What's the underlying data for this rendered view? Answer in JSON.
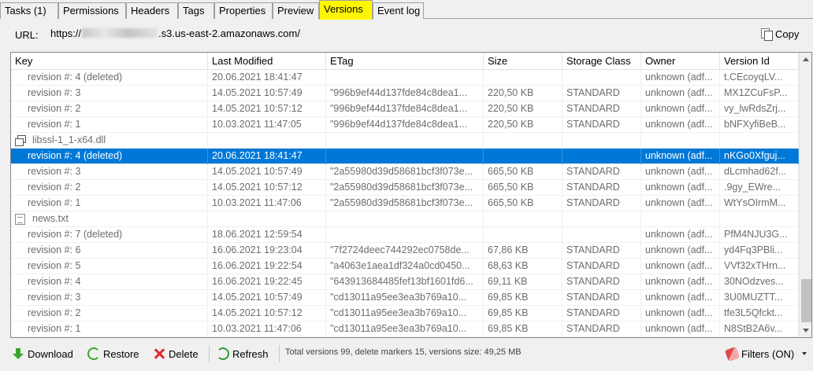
{
  "tabs": [
    "Tasks (1)",
    "Permissions",
    "Headers",
    "Tags",
    "Properties",
    "Preview",
    "Versions",
    "Event log"
  ],
  "active_tab": "Versions",
  "url": {
    "label": "URL:",
    "prefix": "https://",
    "suffix": ".s3.us-east-2.amazonaws.com/"
  },
  "copy_label": "Copy",
  "columns": [
    "Key",
    "Last Modified",
    "ETag",
    "Size",
    "Storage Class",
    "Owner",
    "Version Id"
  ],
  "rows": [
    {
      "type": "rev",
      "key": "revision #: 4 (deleted)",
      "modified": "20.06.2021 18:41:47",
      "etag": "",
      "size": "",
      "class": "",
      "owner": "unknown (adf...",
      "version": "t.CEcoyqLV..."
    },
    {
      "type": "rev",
      "key": "revision #: 3",
      "modified": "14.05.2021 10:57:49",
      "etag": "\"996b9ef44d137fde84c8dea1...",
      "size": "220,50 KB",
      "class": "STANDARD",
      "owner": "unknown (adf...",
      "version": "MX1ZCuFsP..."
    },
    {
      "type": "rev",
      "key": "revision #: 2",
      "modified": "14.05.2021 10:57:12",
      "etag": "\"996b9ef44d137fde84c8dea1...",
      "size": "220,50 KB",
      "class": "STANDARD",
      "owner": "unknown (adf...",
      "version": "vy_lwRdsZrj..."
    },
    {
      "type": "rev",
      "key": "revision #: 1",
      "modified": "10.03.2021 11:47:05",
      "etag": "\"996b9ef44d137fde84c8dea1...",
      "size": "220,50 KB",
      "class": "STANDARD",
      "owner": "unknown (adf...",
      "version": "bNFXyfiBeB..."
    },
    {
      "type": "file",
      "icon": "dll",
      "key": "libssl-1_1-x64.dll",
      "modified": "",
      "etag": "",
      "size": "",
      "class": "",
      "owner": "",
      "version": ""
    },
    {
      "type": "rev",
      "selected": true,
      "key": "revision #: 4 (deleted)",
      "modified": "20.06.2021 18:41:47",
      "etag": "",
      "size": "",
      "class": "",
      "owner": "unknown (adf...",
      "version": "nKGo0Xfguj..."
    },
    {
      "type": "rev",
      "key": "revision #: 3",
      "modified": "14.05.2021 10:57:49",
      "etag": "\"2a55980d39d58681bcf3f073e...",
      "size": "665,50 KB",
      "class": "STANDARD",
      "owner": "unknown (adf...",
      "version": "dLcmhad62f..."
    },
    {
      "type": "rev",
      "key": "revision #: 2",
      "modified": "14.05.2021 10:57:12",
      "etag": "\"2a55980d39d58681bcf3f073e...",
      "size": "665,50 KB",
      "class": "STANDARD",
      "owner": "unknown (adf...",
      "version": ".9gy_EWre..."
    },
    {
      "type": "rev",
      "key": "revision #: 1",
      "modified": "10.03.2021 11:47:06",
      "etag": "\"2a55980d39d58681bcf3f073e...",
      "size": "665,50 KB",
      "class": "STANDARD",
      "owner": "unknown (adf...",
      "version": "WtYsOIrmM..."
    },
    {
      "type": "file",
      "icon": "doc",
      "key": "news.txt",
      "modified": "",
      "etag": "",
      "size": "",
      "class": "",
      "owner": "",
      "version": ""
    },
    {
      "type": "rev",
      "key": "revision #: 7 (deleted)",
      "modified": "18.06.2021 12:59:54",
      "etag": "",
      "size": "",
      "class": "",
      "owner": "unknown (adf...",
      "version": "PfM4NJU3G..."
    },
    {
      "type": "rev",
      "key": "revision #: 6",
      "modified": "16.06.2021 19:23:04",
      "etag": "\"7f2724deec744292ec0758de...",
      "size": "67,86 KB",
      "class": "STANDARD",
      "owner": "unknown (adf...",
      "version": "yd4Fq3PBli..."
    },
    {
      "type": "rev",
      "key": "revision #: 5",
      "modified": "16.06.2021 19:22:54",
      "etag": "\"a4063e1aea1df324a0cd0450...",
      "size": "68,63 KB",
      "class": "STANDARD",
      "owner": "unknown (adf...",
      "version": "VVf32xTHrn..."
    },
    {
      "type": "rev",
      "key": "revision #: 4",
      "modified": "16.06.2021 19:22:45",
      "etag": "\"643913684485fef13bf1601fd6...",
      "size": "69,11 KB",
      "class": "STANDARD",
      "owner": "unknown (adf...",
      "version": "30NOdzves..."
    },
    {
      "type": "rev",
      "key": "revision #: 3",
      "modified": "14.05.2021 10:57:49",
      "etag": "\"cd13011a95ee3ea3b769a10...",
      "size": "69,85 KB",
      "class": "STANDARD",
      "owner": "unknown (adf...",
      "version": "3U0MUZTT..."
    },
    {
      "type": "rev",
      "key": "revision #: 2",
      "modified": "14.05.2021 10:57:12",
      "etag": "\"cd13011a95ee3ea3b769a10...",
      "size": "69,85 KB",
      "class": "STANDARD",
      "owner": "unknown (adf...",
      "version": "tfe3L5Qfckt..."
    },
    {
      "type": "rev",
      "key": "revision #: 1",
      "modified": "10.03.2021 11:47:06",
      "etag": "\"cd13011a95ee3ea3b769a10...",
      "size": "69,85 KB",
      "class": "STANDARD",
      "owner": "unknown (adf...",
      "version": "N8StB2A6v..."
    }
  ],
  "toolbar": {
    "download": "Download",
    "restore": "Restore",
    "delete": "Delete",
    "refresh": "Refresh",
    "status": "Total versions 99, delete markers 15, versions size: 49,25 MB",
    "filters": "Filters (ON)"
  }
}
